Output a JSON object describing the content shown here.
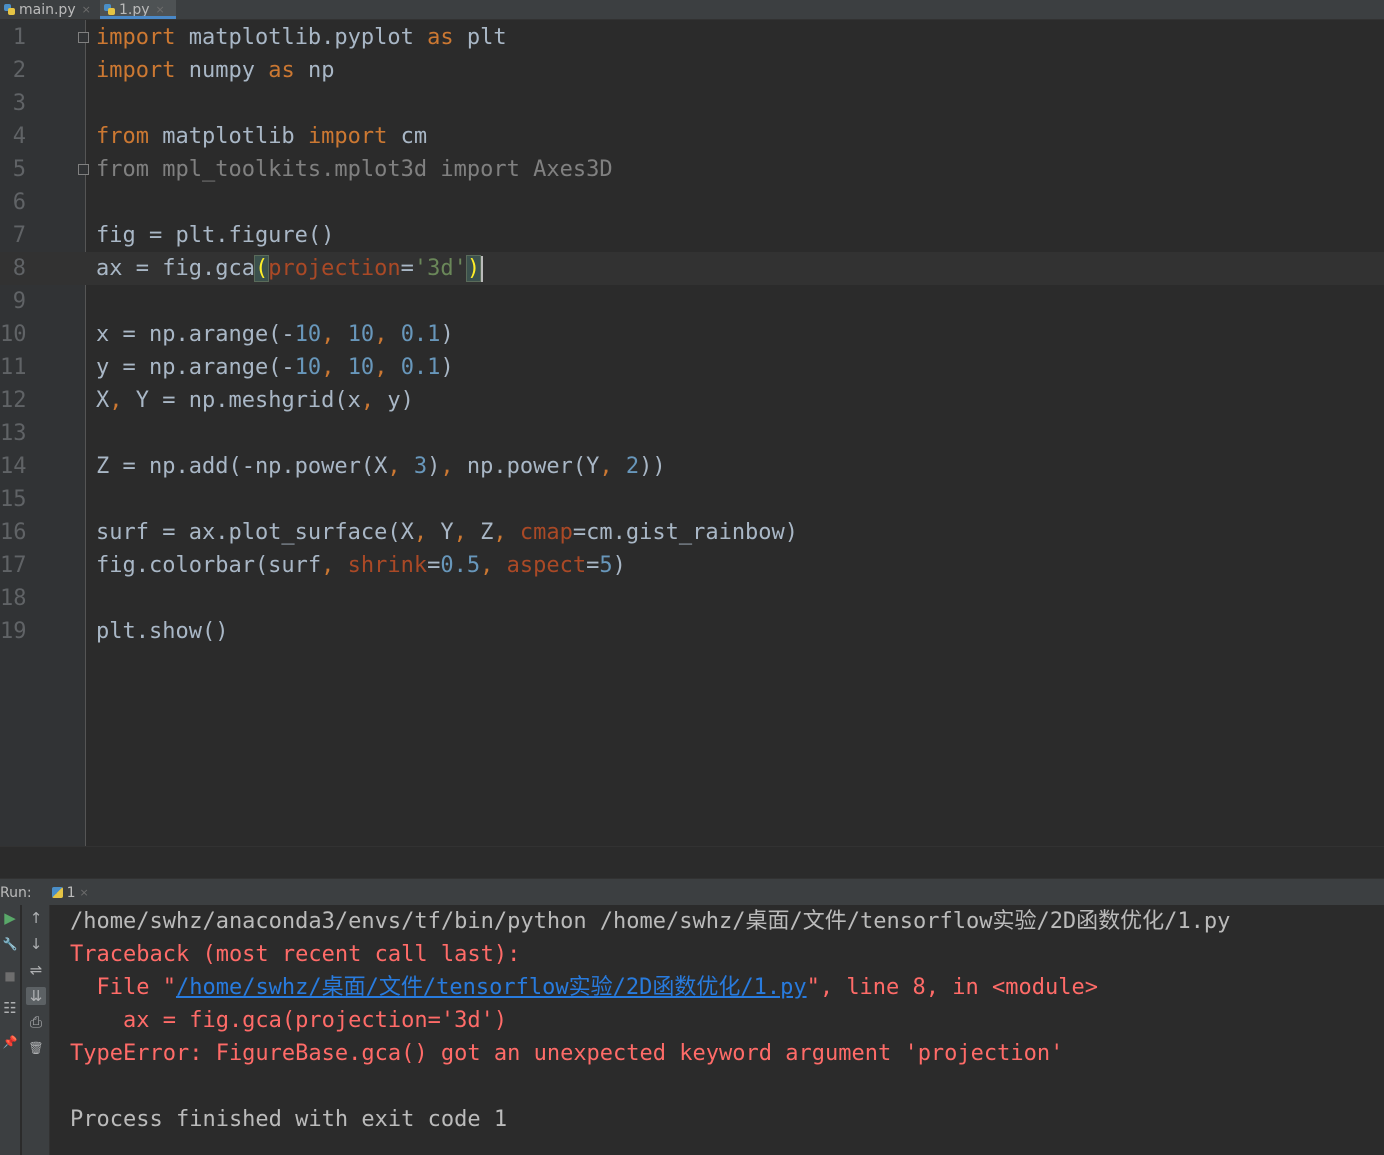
{
  "tabs": [
    {
      "label": "main.py",
      "close": "×",
      "active": false
    },
    {
      "label": "1.py",
      "close": "×",
      "active": true
    }
  ],
  "editor": {
    "line_numbers": [
      "1",
      "2",
      "3",
      "4",
      "5",
      "6",
      "7",
      "8",
      "9",
      "10",
      "11",
      "12",
      "13",
      "14",
      "15",
      "16",
      "17",
      "18",
      "19"
    ],
    "lines": {
      "l1": {
        "kw1": "import",
        "t1": " matplotlib.pyplot ",
        "kw2": "as",
        "t2": " plt"
      },
      "l2": {
        "kw1": "import",
        "t1": " numpy ",
        "kw2": "as",
        "t2": " np"
      },
      "l4": {
        "kw1": "from",
        "t1": " matplotlib ",
        "kw2": "import",
        "t2": " cm"
      },
      "l5": {
        "text": "from mpl_toolkits.mplot3d import Axes3D"
      },
      "l7": {
        "text": "fig = plt.figure()"
      },
      "l8": {
        "t1": "ax = fig.gca",
        "open": "(",
        "prm": "projection",
        "eq": "=",
        "str": "'3d'",
        "close": ")"
      },
      "l10": {
        "t1": "x = np.arange(-",
        "n1": "10",
        "s1": ", ",
        "n2": "10",
        "s2": ", ",
        "n3": "0.1",
        "t2": ")"
      },
      "l11": {
        "t1": "y = np.arange(-",
        "n1": "10",
        "s1": ", ",
        "n2": "10",
        "s2": ", ",
        "n3": "0.1",
        "t2": ")"
      },
      "l12": {
        "t1": "X",
        "s1": ", ",
        "t2": "Y = np.meshgrid(x",
        "s2": ", ",
        "t3": "y)"
      },
      "l14": {
        "t1": "Z = np.add(-np.power(X",
        "s1": ", ",
        "n1": "3",
        "t2": ")",
        "s2": ", ",
        "t3": "np.power(Y",
        "s3": ", ",
        "n2": "2",
        "t4": "))"
      },
      "l16": {
        "t1": "surf = ax.plot_surface(X",
        "s1": ", ",
        "t2": "Y",
        "s2": ", ",
        "t3": "Z",
        "s3": ", ",
        "prm": "cmap",
        "t4": "=cm.gist_rainbow)"
      },
      "l17": {
        "t1": "fig.colorbar(surf",
        "s1": ", ",
        "prm1": "shrink",
        "eq1": "=",
        "n1": "0.5",
        "s2": ", ",
        "prm2": "aspect",
        "eq2": "=",
        "n2": "5",
        "t2": ")"
      },
      "l19": {
        "text": "plt.show()"
      }
    }
  },
  "run": {
    "label": "Run:",
    "tab_label": "1",
    "tab_close": "×",
    "toolbar": {
      "rerun": "▶",
      "wrench": "🔧",
      "stop": "■",
      "layout": "☷",
      "pin": "📌",
      "up": "↑",
      "down": "↓",
      "wrap": "⇌",
      "scroll_end": "⇊",
      "print": "⎙",
      "trash": "🗑"
    },
    "console": {
      "cmd": "/home/swhz/anaconda3/envs/tf/bin/python /home/swhz/桌面/文件/tensorflow实验/2D函数优化/1.py",
      "traceback": "Traceback (most recent call last):",
      "file_prefix": "  File \"",
      "file_link": "/home/swhz/桌面/文件/tensorflow实验/2D函数优化/1.py",
      "file_suffix": "\", line 8, in <module>",
      "code_line": "    ax = fig.gca(projection='3d')",
      "error": "TypeError: FigureBase.gca() got an unexpected keyword argument 'projection'",
      "exit": "Process finished with exit code 1"
    }
  },
  "colors": {
    "background": "#2b2b2b",
    "keyword": "#cc7832",
    "number": "#6897bb",
    "string": "#6a8759",
    "param": "#aa4926",
    "error": "#ff6b68",
    "link": "#287bde"
  }
}
